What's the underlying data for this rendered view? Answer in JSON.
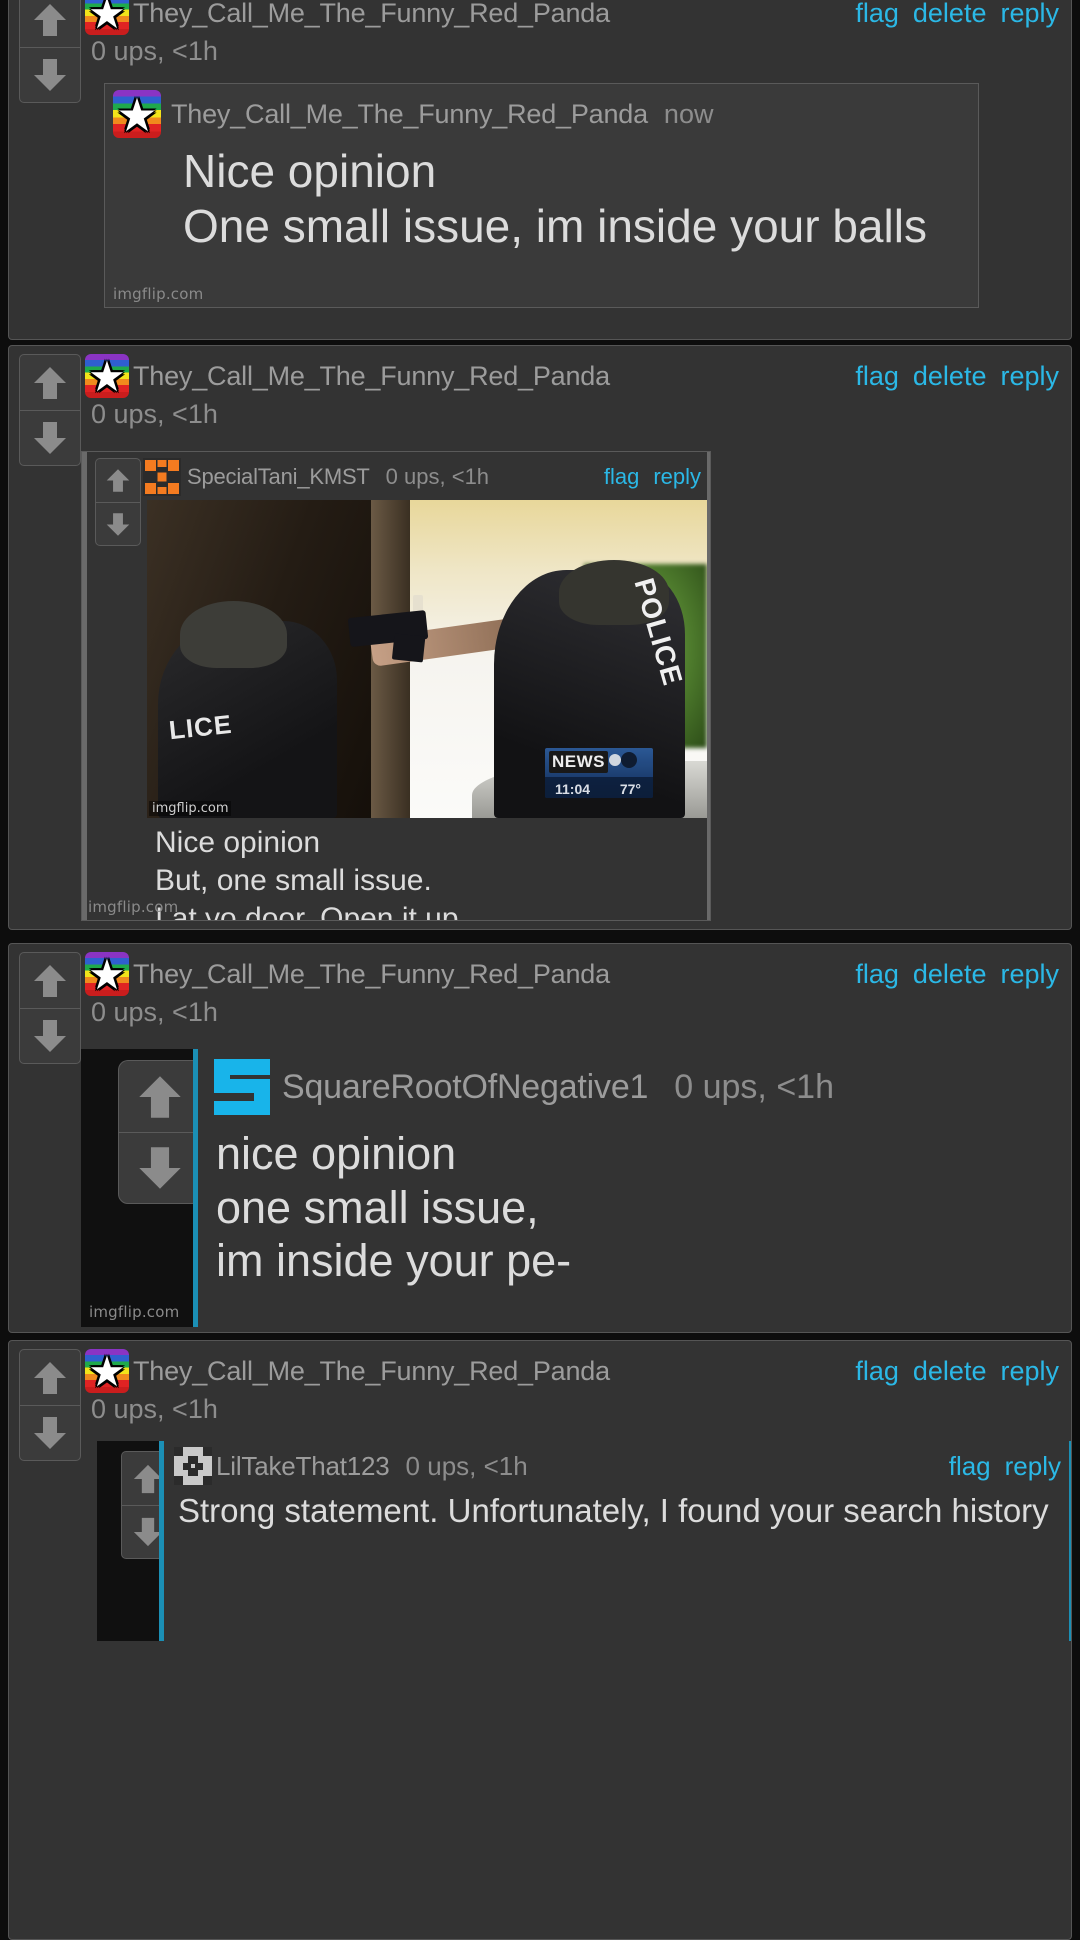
{
  "theme": {
    "page_bg": "#0d0d0d",
    "card_bg": "#333333",
    "card_border": "#555555",
    "link_color": "#2bb8e6",
    "username_color": "#9c9c9c",
    "meme_text_color": "#dcdcdc",
    "accent_cyan": "#18b4ea",
    "accent_orange": "#f47b20"
  },
  "watermark": "imgflip.com",
  "comments": [
    {
      "id": "comment-1",
      "username": "They_Call_Me_The_Funny_Red_Panda",
      "avatar": "rainbow-star-avatar",
      "stats": "0 ups, <1h",
      "actions": [
        "flag",
        "delete",
        "reply"
      ],
      "meme": {
        "username": "They_Call_Me_The_Funny_Red_Panda",
        "avatar": "rainbow-star-avatar",
        "time": "now",
        "text": "Nice opinion\nOne small issue, im inside your balls",
        "watermark": "imgflip.com"
      }
    },
    {
      "id": "comment-2",
      "username": "They_Call_Me_The_Funny_Red_Panda",
      "avatar": "rainbow-star-avatar",
      "stats": "0 ups, <1h",
      "actions": [
        "flag",
        "delete",
        "reply"
      ],
      "meme": {
        "username": "SpecialTani_KMST",
        "avatar": "orange-squares-avatar",
        "stats": "0 ups, <1h",
        "actions": [
          "flag",
          "reply"
        ],
        "text": "Nice opinion\nBut, one small issue.\nI at yo door. Open it up.",
        "watermark": "imgflip.com",
        "photo": {
          "description": "police-swat-breach-photo",
          "left_officer_label": "LICE",
          "right_officer_label": "POLICE",
          "news_overlay": {
            "channel": "NEWS",
            "time": "11:04",
            "temperature": "77°"
          },
          "photo_watermark": "imgflip.com"
        }
      }
    },
    {
      "id": "comment-3",
      "username": "They_Call_Me_The_Funny_Red_Panda",
      "avatar": "rainbow-star-avatar",
      "stats": "0 ups, <1h",
      "actions": [
        "flag",
        "delete",
        "reply"
      ],
      "meme": {
        "username": "SquareRootOfNegative1",
        "avatar": "cyan-s-avatar",
        "stats": "0 ups, <1h",
        "text": "nice opinion\none small issue,\nim inside your pe-",
        "watermark": "imgflip.com"
      }
    },
    {
      "id": "comment-4",
      "username": "They_Call_Me_The_Funny_Red_Panda",
      "avatar": "rainbow-star-avatar",
      "stats": "0 ups, <1h",
      "actions": [
        "flag",
        "delete",
        "reply"
      ],
      "meme": {
        "username": "LilTakeThat123",
        "avatar": "checker-avatar",
        "stats": "0 ups, <1h",
        "actions": [
          "flag",
          "reply"
        ],
        "text": "Strong statement. Unfortunately, I found your search history"
      }
    }
  ],
  "vote": {
    "upvote_label": "upvote",
    "downvote_label": "downvote"
  }
}
